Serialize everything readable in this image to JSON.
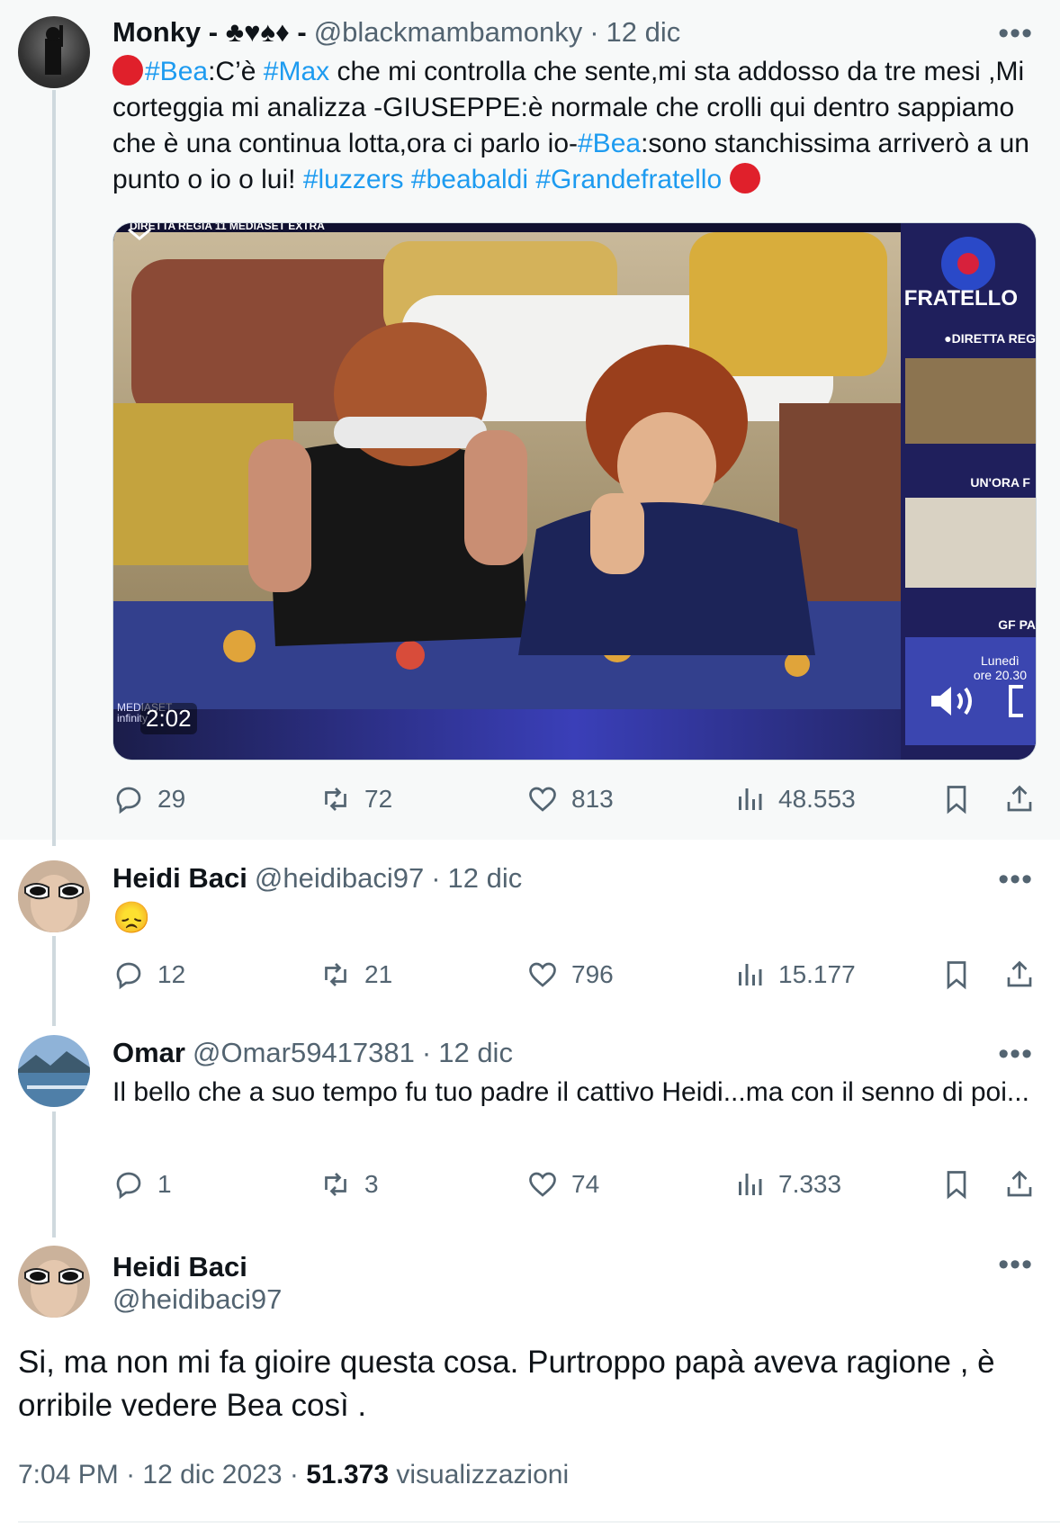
{
  "tweets": [
    {
      "name": "Monky - ♣♥♠♦ -",
      "handle": "@blackmambamonky",
      "date": "12 dic",
      "text_parts": [
        {
          "t": "#Bea",
          "tag": true
        },
        {
          "t": ":C’è ",
          "tag": false
        },
        {
          "t": "#Max",
          "tag": true
        },
        {
          "t": " che mi controlla che sente,mi sta addosso da tre mesi ,Mi corteggia mi analizza -GIUSEPPE:è normale che crolli qui dentro sappiamo che è una continua lotta,ora ci parlo io-",
          "tag": false
        },
        {
          "t": "#Bea",
          "tag": true
        },
        {
          "t": ":sono stanchissima arriverò a un punto o io o lui! ",
          "tag": false
        },
        {
          "t": "#luzzers",
          "tag": true
        },
        {
          "t": " ",
          "tag": false
        },
        {
          "t": "#beabaldi",
          "tag": true
        },
        {
          "t": " ",
          "tag": false
        },
        {
          "t": "#Grandefratello",
          "tag": true
        }
      ],
      "video": {
        "duration": "2:02",
        "overlay_texts": [
          "FRATELLO",
          "●DIRETTA",
          "REG",
          "UN'ORA F",
          "GF PA",
          "Lunedì",
          "ore 20.30",
          "DIRETTA",
          "REGIA 11 MEDIASET EXTRA",
          "MEDIASET",
          "infinity"
        ]
      },
      "stats": {
        "replies": "29",
        "retweets": "72",
        "likes": "813",
        "views": "48.553"
      }
    },
    {
      "name": "Heidi Baci",
      "handle": "@heidibaci97",
      "date": "12 dic",
      "emoji": "😞",
      "stats": {
        "replies": "12",
        "retweets": "21",
        "likes": "796",
        "views": "15.177"
      }
    },
    {
      "name": "Omar",
      "handle": "@Omar59417381",
      "date": "12 dic",
      "text": "Il bello che a suo tempo fu tuo padre il cattivo Heidi...ma con il senno di poi...",
      "stats": {
        "replies": "1",
        "retweets": "3",
        "likes": "74",
        "views": "7.333"
      }
    }
  ],
  "main": {
    "name": "Heidi Baci",
    "handle": "@heidibaci97",
    "text": "Si, ma non mi fa gioire questa cosa. Purtroppo papà aveva ragione , è orribile vedere Bea così .",
    "time": "7:04 PM",
    "date": "12 dic 2023",
    "views_count": "51.373",
    "views_label": "visualizzazioni"
  },
  "labels": {
    "sep": "·",
    "more": "•••"
  },
  "colors": {
    "link": "#1d9bf0",
    "muted": "#536471",
    "text": "#0f1419",
    "thread": "#cfd9de"
  }
}
